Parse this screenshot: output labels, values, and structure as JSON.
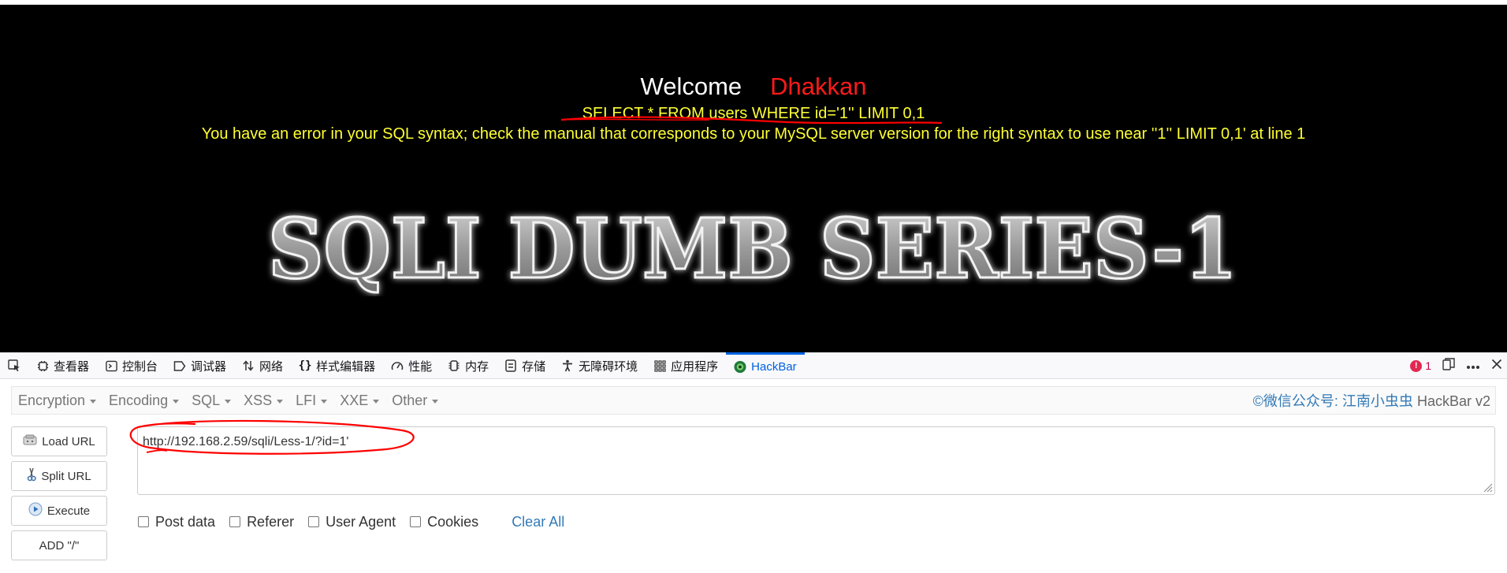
{
  "page": {
    "welcome": "Welcome",
    "user": "Dhakkan",
    "query": "SELECT * FROM users WHERE id='1'' LIMIT 0,1",
    "error": "You have an error in your SQL syntax; check the manual that corresponds to your MySQL server version for the right syntax to use near ''1'' LIMIT 0,1' at line 1",
    "banner": "SQLI DUMB SERIES-1"
  },
  "devtools": {
    "tabs": [
      {
        "label": "查看器",
        "icon": "inspector-icon"
      },
      {
        "label": "控制台",
        "icon": "console-icon"
      },
      {
        "label": "调试器",
        "icon": "debugger-icon"
      },
      {
        "label": "网络",
        "icon": "network-icon"
      },
      {
        "label": "样式编辑器",
        "icon": "style-editor-icon"
      },
      {
        "label": "性能",
        "icon": "performance-icon"
      },
      {
        "label": "内存",
        "icon": "memory-icon"
      },
      {
        "label": "存储",
        "icon": "storage-icon"
      },
      {
        "label": "无障碍环境",
        "icon": "accessibility-icon"
      },
      {
        "label": "应用程序",
        "icon": "application-icon"
      },
      {
        "label": "HackBar",
        "icon": "hackbar-icon"
      }
    ],
    "active_tab": "HackBar",
    "error_count": "1",
    "accent": "#0061e0"
  },
  "hackbar": {
    "menus": [
      "Encryption",
      "Encoding",
      "SQL",
      "XSS",
      "LFI",
      "XXE",
      "Other"
    ],
    "credit_link": "©微信公众号: 江南小虫虫",
    "credit_name": "HackBar v2",
    "buttons": {
      "load": "Load URL",
      "split": "Split URL",
      "execute": "Execute",
      "add": "ADD \"/\""
    },
    "url": "http://192.168.2.59/sqli/Less-1/?id=1'",
    "options": {
      "post": "Post data",
      "referer": "Referer",
      "ua": "User Agent",
      "cookies": "Cookies"
    },
    "clear": "Clear All"
  },
  "colors": {
    "page_bg": "#000000",
    "welcome": "#ffffff",
    "username": "#ff1a1a",
    "sql_text": "#ffff33",
    "annotation": "#ff0000",
    "link": "#337ab7"
  }
}
